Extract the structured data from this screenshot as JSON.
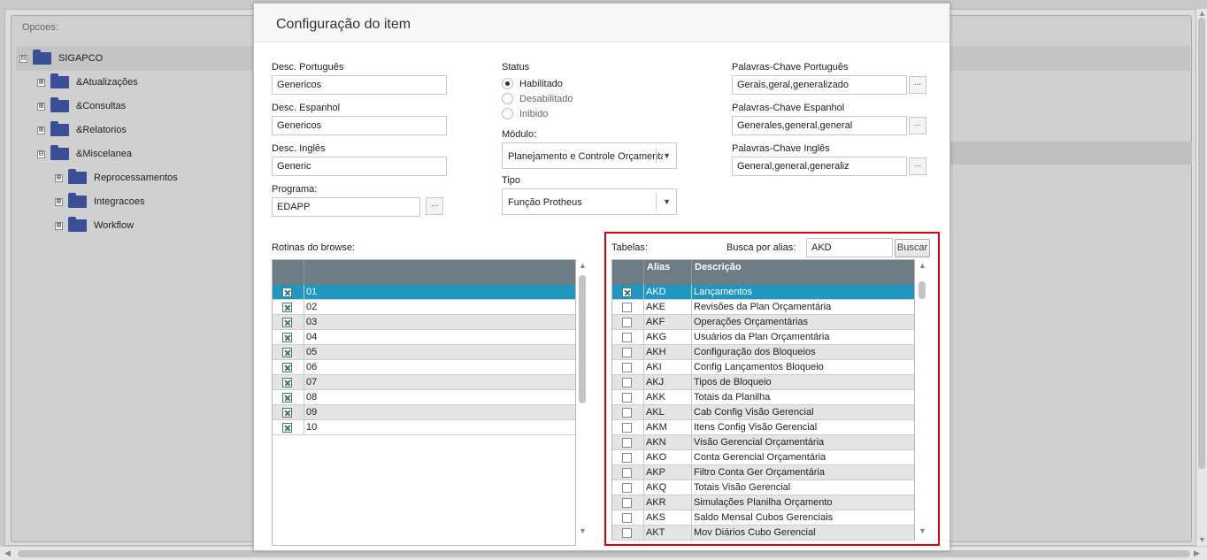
{
  "background": {
    "panel_title": "Opcoes:",
    "tree": [
      {
        "label": "SIGAPCO",
        "expander": "⊟"
      },
      {
        "label": "&Atualizações",
        "expander": "⊞"
      },
      {
        "label": "&Consultas",
        "expander": "⊞"
      },
      {
        "label": "&Relatorios",
        "expander": "⊞"
      },
      {
        "label": "&Miscelanea",
        "expander": "⊟"
      },
      {
        "label": "Reprocessamentos",
        "expander": "⊞"
      },
      {
        "label": "Integracoes",
        "expander": "⊞"
      },
      {
        "label": "Workflow",
        "expander": "⊞"
      }
    ]
  },
  "dialog": {
    "title": "Configuração do item",
    "desc_pt": {
      "label": "Desc. Português",
      "value": "Genericos"
    },
    "desc_es": {
      "label": "Desc. Espanhol",
      "value": "Genericos"
    },
    "desc_en": {
      "label": "Desc. Inglês",
      "value": "Generic"
    },
    "programa": {
      "label": "Programa:",
      "value": "EDAPP",
      "button": "..."
    },
    "status": {
      "label": "Status",
      "options": [
        "Habilitado",
        "Desabilitado",
        "Inibido"
      ],
      "selected": "Habilitado"
    },
    "modulo": {
      "label": "Módulo:",
      "value": "Planejamento e Controle Orçamentár"
    },
    "tipo": {
      "label": "Tipo",
      "value": "Função Protheus"
    },
    "kw_pt": {
      "label": "Palavras-Chave Português",
      "value": "Gerais,geral,generalizado",
      "button": "..."
    },
    "kw_es": {
      "label": "Palavras-Chave Espanhol",
      "value": "Generales,general,general",
      "button": "..."
    },
    "kw_en": {
      "label": "Palavras-Chave Inglês",
      "value": "General,general,generaliz",
      "button": "..."
    },
    "rotinas": {
      "label": "Rotinas do browse:",
      "rows": [
        {
          "value": "01",
          "checked": true,
          "selected": true
        },
        {
          "value": "02",
          "checked": true
        },
        {
          "value": "03",
          "checked": true
        },
        {
          "value": "04",
          "checked": true
        },
        {
          "value": "05",
          "checked": true
        },
        {
          "value": "06",
          "checked": true
        },
        {
          "value": "07",
          "checked": true
        },
        {
          "value": "08",
          "checked": true
        },
        {
          "value": "09",
          "checked": true
        },
        {
          "value": "10",
          "checked": true
        }
      ]
    },
    "tabelas": {
      "label": "Tabelas:",
      "search_label": "Busca por alias:",
      "search_value": "AKD",
      "search_button": "Buscar",
      "col_alias": "Alias",
      "col_desc": "Descrição",
      "rows": [
        {
          "alias": "AKD",
          "desc": "Lançamentos",
          "checked": true,
          "selected": true
        },
        {
          "alias": "AKE",
          "desc": "Revisões da Plan Orçamentária",
          "checked": false
        },
        {
          "alias": "AKF",
          "desc": "Operações Orçamentárias",
          "checked": false
        },
        {
          "alias": "AKG",
          "desc": "Usuários da Plan Orçamentária",
          "checked": false
        },
        {
          "alias": "AKH",
          "desc": "Configuração dos Bloqueios",
          "checked": false
        },
        {
          "alias": "AKI",
          "desc": "Config Lançamentos Bloqueio",
          "checked": false
        },
        {
          "alias": "AKJ",
          "desc": "Tipos de Bloqueio",
          "checked": false
        },
        {
          "alias": "AKK",
          "desc": "Totais da Planilha",
          "checked": false
        },
        {
          "alias": "AKL",
          "desc": "Cab Config Visão Gerencial",
          "checked": false
        },
        {
          "alias": "AKM",
          "desc": "Itens Config Visão Gerencial",
          "checked": false
        },
        {
          "alias": "AKN",
          "desc": "Visão Gerencial Orçamentária",
          "checked": false
        },
        {
          "alias": "AKO",
          "desc": "Conta Gerencial Orçamentária",
          "checked": false
        },
        {
          "alias": "AKP",
          "desc": "Filtro Conta Ger Orçamentária",
          "checked": false
        },
        {
          "alias": "AKQ",
          "desc": "Totais Visão Gerencial",
          "checked": false
        },
        {
          "alias": "AKR",
          "desc": "Simulações Planilha Orçamento",
          "checked": false
        },
        {
          "alias": "AKS",
          "desc": "Saldo Mensal Cubos Gerenciais",
          "checked": false
        },
        {
          "alias": "AKT",
          "desc": "Mov Diários Cubo Gerencial",
          "checked": false
        }
      ]
    }
  },
  "colors": {
    "selected_row": "#1f97c1",
    "grid_header": "#6d7c85",
    "highlight_border": "#d9000d"
  }
}
